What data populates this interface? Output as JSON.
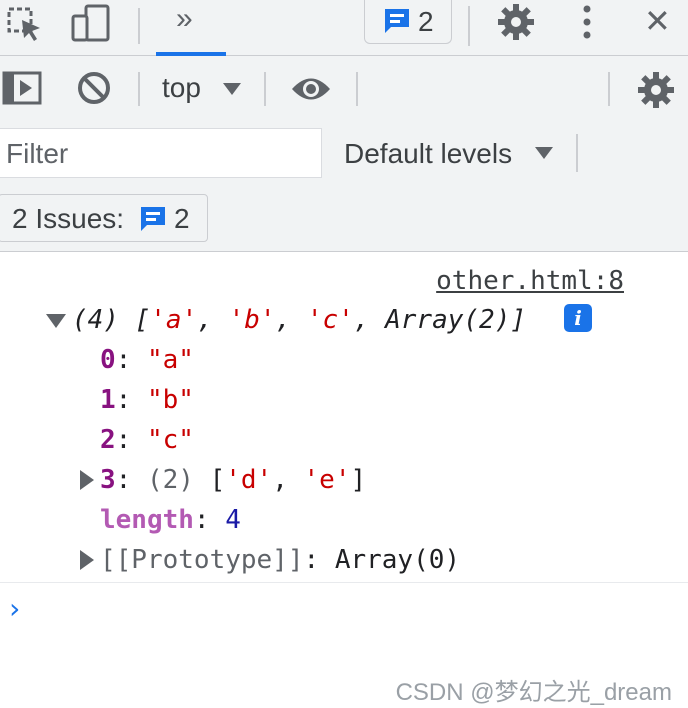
{
  "toolbar": {
    "message_count": "2",
    "more_tabs_glyph": "»",
    "close_glyph": "✕"
  },
  "console_toolbar": {
    "context": "top"
  },
  "filter": {
    "placeholder": "Filter",
    "levels_label": "Default levels"
  },
  "issues": {
    "label": "2 Issues:",
    "count": "2"
  },
  "log": {
    "source_link": "other.html:8",
    "summary": {
      "prefix": "(4) [",
      "items": [
        "'a'",
        "'b'",
        "'c'"
      ],
      "tail": "Array(2)]"
    },
    "entries": [
      {
        "key": "0",
        "value": "\"a\""
      },
      {
        "key": "1",
        "value": "\"b\""
      },
      {
        "key": "2",
        "value": "\"c\""
      }
    ],
    "nested": {
      "key": "3",
      "count": "(2)",
      "items": [
        "'d'",
        "'e'"
      ]
    },
    "length": {
      "key": "length",
      "value": "4"
    },
    "prototype": {
      "key": "[[Prototype]]",
      "value": "Array(0)"
    }
  },
  "prompt_glyph": "›",
  "watermark": "CSDN @梦幻之光_dream",
  "colors": {
    "accent": "#1a73e8",
    "string": "#c80000",
    "key": "#881280",
    "number": "#1a1aa6"
  },
  "icons": [
    "inspect-icon",
    "device-toggle-icon",
    "more-tabs-icon",
    "message-icon",
    "gear-icon",
    "kebab-menu-icon",
    "close-icon",
    "sidebar-toggle-icon",
    "clear-console-icon",
    "dropdown-arrow-icon",
    "eye-icon",
    "info-icon"
  ]
}
